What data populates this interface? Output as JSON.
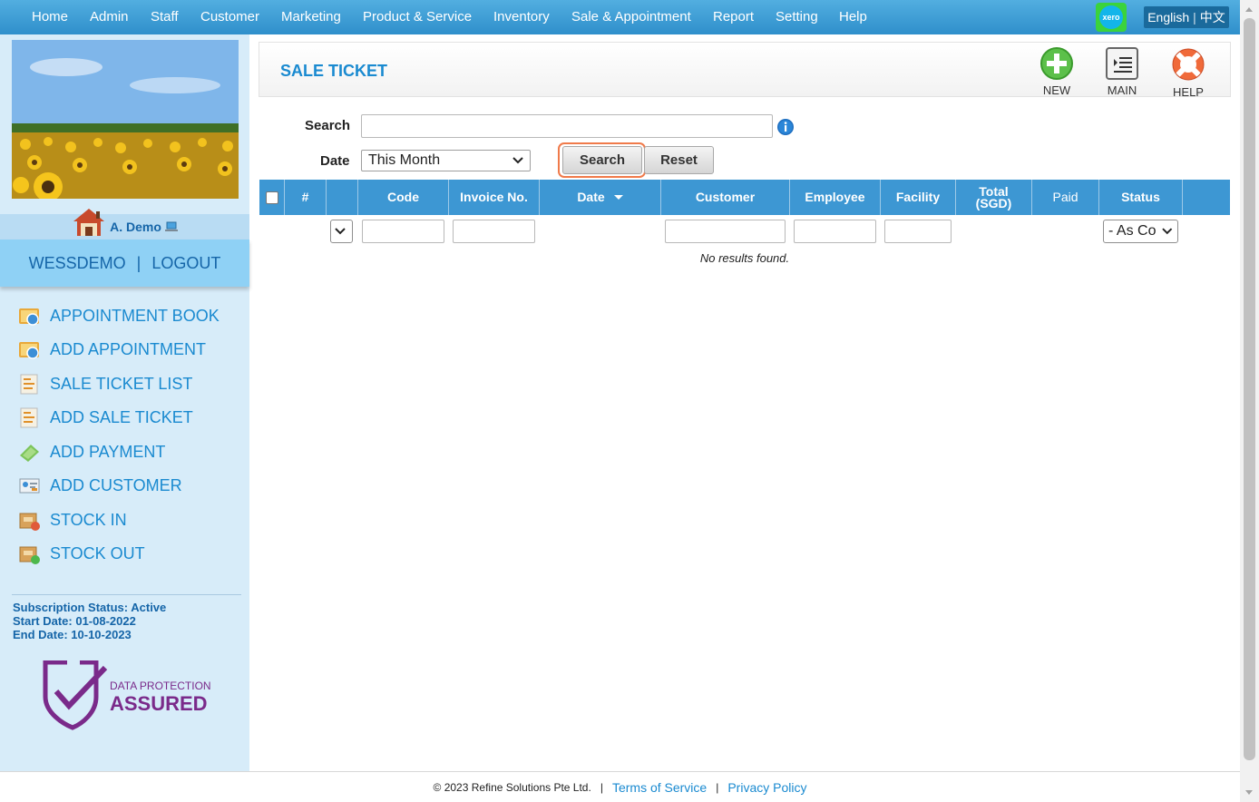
{
  "topnav": {
    "items": [
      "Home",
      "Admin",
      "Staff",
      "Customer",
      "Marketing",
      "Product & Service",
      "Inventory",
      "Sale & Appointment",
      "Report",
      "Setting",
      "Help"
    ],
    "xero_text": "xero",
    "lang_english": "English",
    "lang_separator": "|",
    "lang_chinese": "中文"
  },
  "sidebar": {
    "user_name": "A. Demo",
    "account": "WESSDEMO",
    "account_separator": "|",
    "logout": "LOGOUT",
    "menu": [
      {
        "label": "APPOINTMENT BOOK",
        "icon": "appointment-book-icon"
      },
      {
        "label": "ADD APPOINTMENT",
        "icon": "add-appointment-icon"
      },
      {
        "label": "SALE TICKET LIST",
        "icon": "sale-ticket-list-icon"
      },
      {
        "label": "ADD SALE TICKET",
        "icon": "add-sale-ticket-icon"
      },
      {
        "label": "ADD PAYMENT",
        "icon": "payment-icon"
      },
      {
        "label": "ADD CUSTOMER",
        "icon": "add-customer-icon"
      },
      {
        "label": "STOCK IN",
        "icon": "stock-in-icon"
      },
      {
        "label": "STOCK OUT",
        "icon": "stock-out-icon"
      }
    ],
    "subscription_status": "Subscription Status: Active",
    "start_date": "Start Date: 01-08-2022",
    "end_date": "End Date: 10-10-2023",
    "badge_line1": "DATA PROTECTION",
    "badge_line2": "ASSURED"
  },
  "page": {
    "title": "SALE TICKET",
    "toolbar": {
      "new": "NEW",
      "main": "MAIN",
      "help": "HELP"
    }
  },
  "filters": {
    "search_label": "Search",
    "search_value": "",
    "date_label": "Date",
    "date_value": "This Month",
    "search_button": "Search",
    "reset_button": "Reset"
  },
  "table": {
    "columns": [
      "#",
      "",
      "Code",
      "Invoice No.",
      "Date",
      "Customer",
      "Employee",
      "Facility",
      "Total (SGD)",
      "Paid",
      "Status"
    ],
    "total_line1": "Total",
    "total_line2": "(SGD)",
    "status_filter_value": "- As Co",
    "empty_message": "No results found."
  },
  "footer": {
    "copyright": "© 2023 Refine Solutions Pte Ltd.",
    "separator": "|",
    "terms": "Terms of Service",
    "privacy": "Privacy Policy"
  },
  "colors": {
    "nav_bg": "#3d97d3",
    "accent_blue": "#1a8ad0",
    "sidebar_bg": "#d7ecf9",
    "search_highlight": "#f07a4a"
  }
}
